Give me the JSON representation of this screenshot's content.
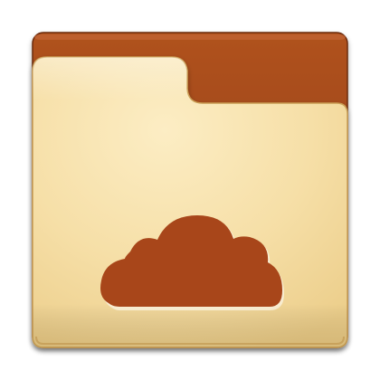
{
  "icon": {
    "name": "cloud-folder-icon",
    "colors": {
      "folder_back_top": "#a8491a",
      "folder_back_bottom": "#8a3a12",
      "folder_back_edge": "#6b2a0a",
      "folder_front_light": "#fbeabb",
      "folder_front_mid": "#f6dda2",
      "folder_front_dark": "#efd08c",
      "folder_front_edge": "#caa257",
      "cloud": "#a8461a",
      "cloud_shadow": "#ffffff"
    }
  }
}
